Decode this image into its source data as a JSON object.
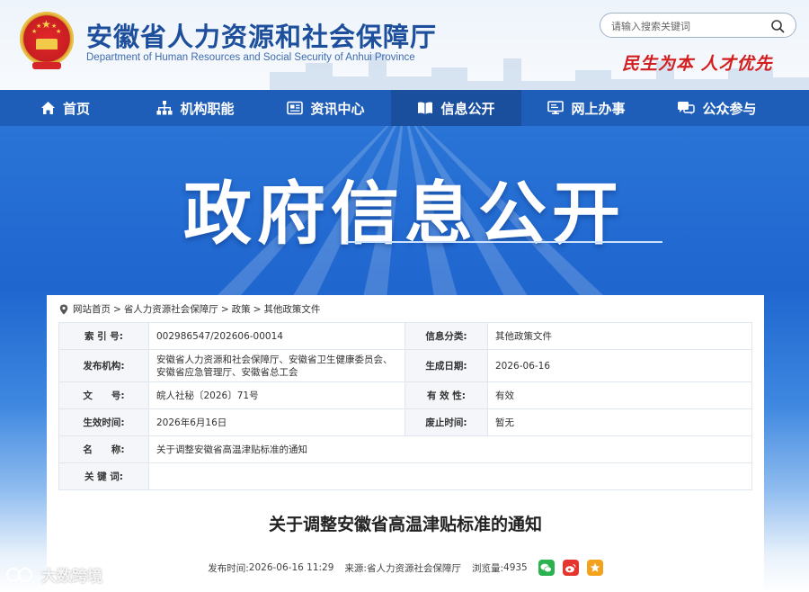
{
  "header": {
    "title": "安徽省人力资源和社会保障厅",
    "subtitle": "Department of Human Resources and Social Security of Anhui Province",
    "search_placeholder": "请输入搜索关键词",
    "slogan": "民生为本  人才优先",
    "emblem_icon": "national-emblem-icon"
  },
  "nav": {
    "items": [
      {
        "label": "首页",
        "icon": "home-icon"
      },
      {
        "label": "机构职能",
        "icon": "org-chart-icon"
      },
      {
        "label": "资讯中心",
        "icon": "news-icon"
      },
      {
        "label": "信息公开",
        "icon": "book-icon"
      },
      {
        "label": "网上办事",
        "icon": "monitor-icon"
      },
      {
        "label": "公众参与",
        "icon": "chat-icon"
      }
    ],
    "active": "信息公开"
  },
  "banner": {
    "title": "政府信息公开"
  },
  "breadcrumb": [
    "网站首页",
    "省人力资源社会保障厅",
    "政策",
    "其他政策文件"
  ],
  "meta": {
    "index_label": "索 引 号:",
    "index_value": "002986547/202606-00014",
    "category_label": "信息分类:",
    "category_value": "其他政策文件",
    "issuer_label": "发布机构:",
    "issuer_value": "安徽省人力资源和社会保障厅、安徽省卫生健康委员会、安徽省应急管理厅、安徽省总工会",
    "created_label": "生成日期:",
    "created_value": "2026-06-16",
    "doc_no_label": "文　　号:",
    "doc_no_value": "皖人社秘〔2026〕71号",
    "validity_label": "有 效 性:",
    "validity_value": "有效",
    "effective_label": "生效时间:",
    "effective_value": "2026年6月16日",
    "repeal_label": "废止时间:",
    "repeal_value": "暂无",
    "name_label": "名　　称:",
    "name_value": "关于调整安徽省高温津贴标准的通知",
    "keywords_label": "关 键 词:",
    "keywords_value": ""
  },
  "document": {
    "title": "关于调整安徽省高温津贴标准的通知",
    "publish_time_label": "发布时间:",
    "publish_time": "2026-06-16 11:29",
    "source_label": "来源:",
    "source": "省人力资源社会保障厅",
    "views_label": "浏览量:",
    "views": "4935"
  },
  "share": [
    "wechat-icon",
    "weibo-icon",
    "favorite-icon"
  ],
  "watermark": "大数跨境",
  "colors": {
    "nav_bg": "#1f5eb8",
    "nav_active": "#1a4f9e",
    "title_blue": "#1d4f9c",
    "slogan_red": "#d21e1e",
    "wechat": "#2ab24f",
    "weibo": "#e6352f",
    "favorite": "#f3a21b"
  }
}
